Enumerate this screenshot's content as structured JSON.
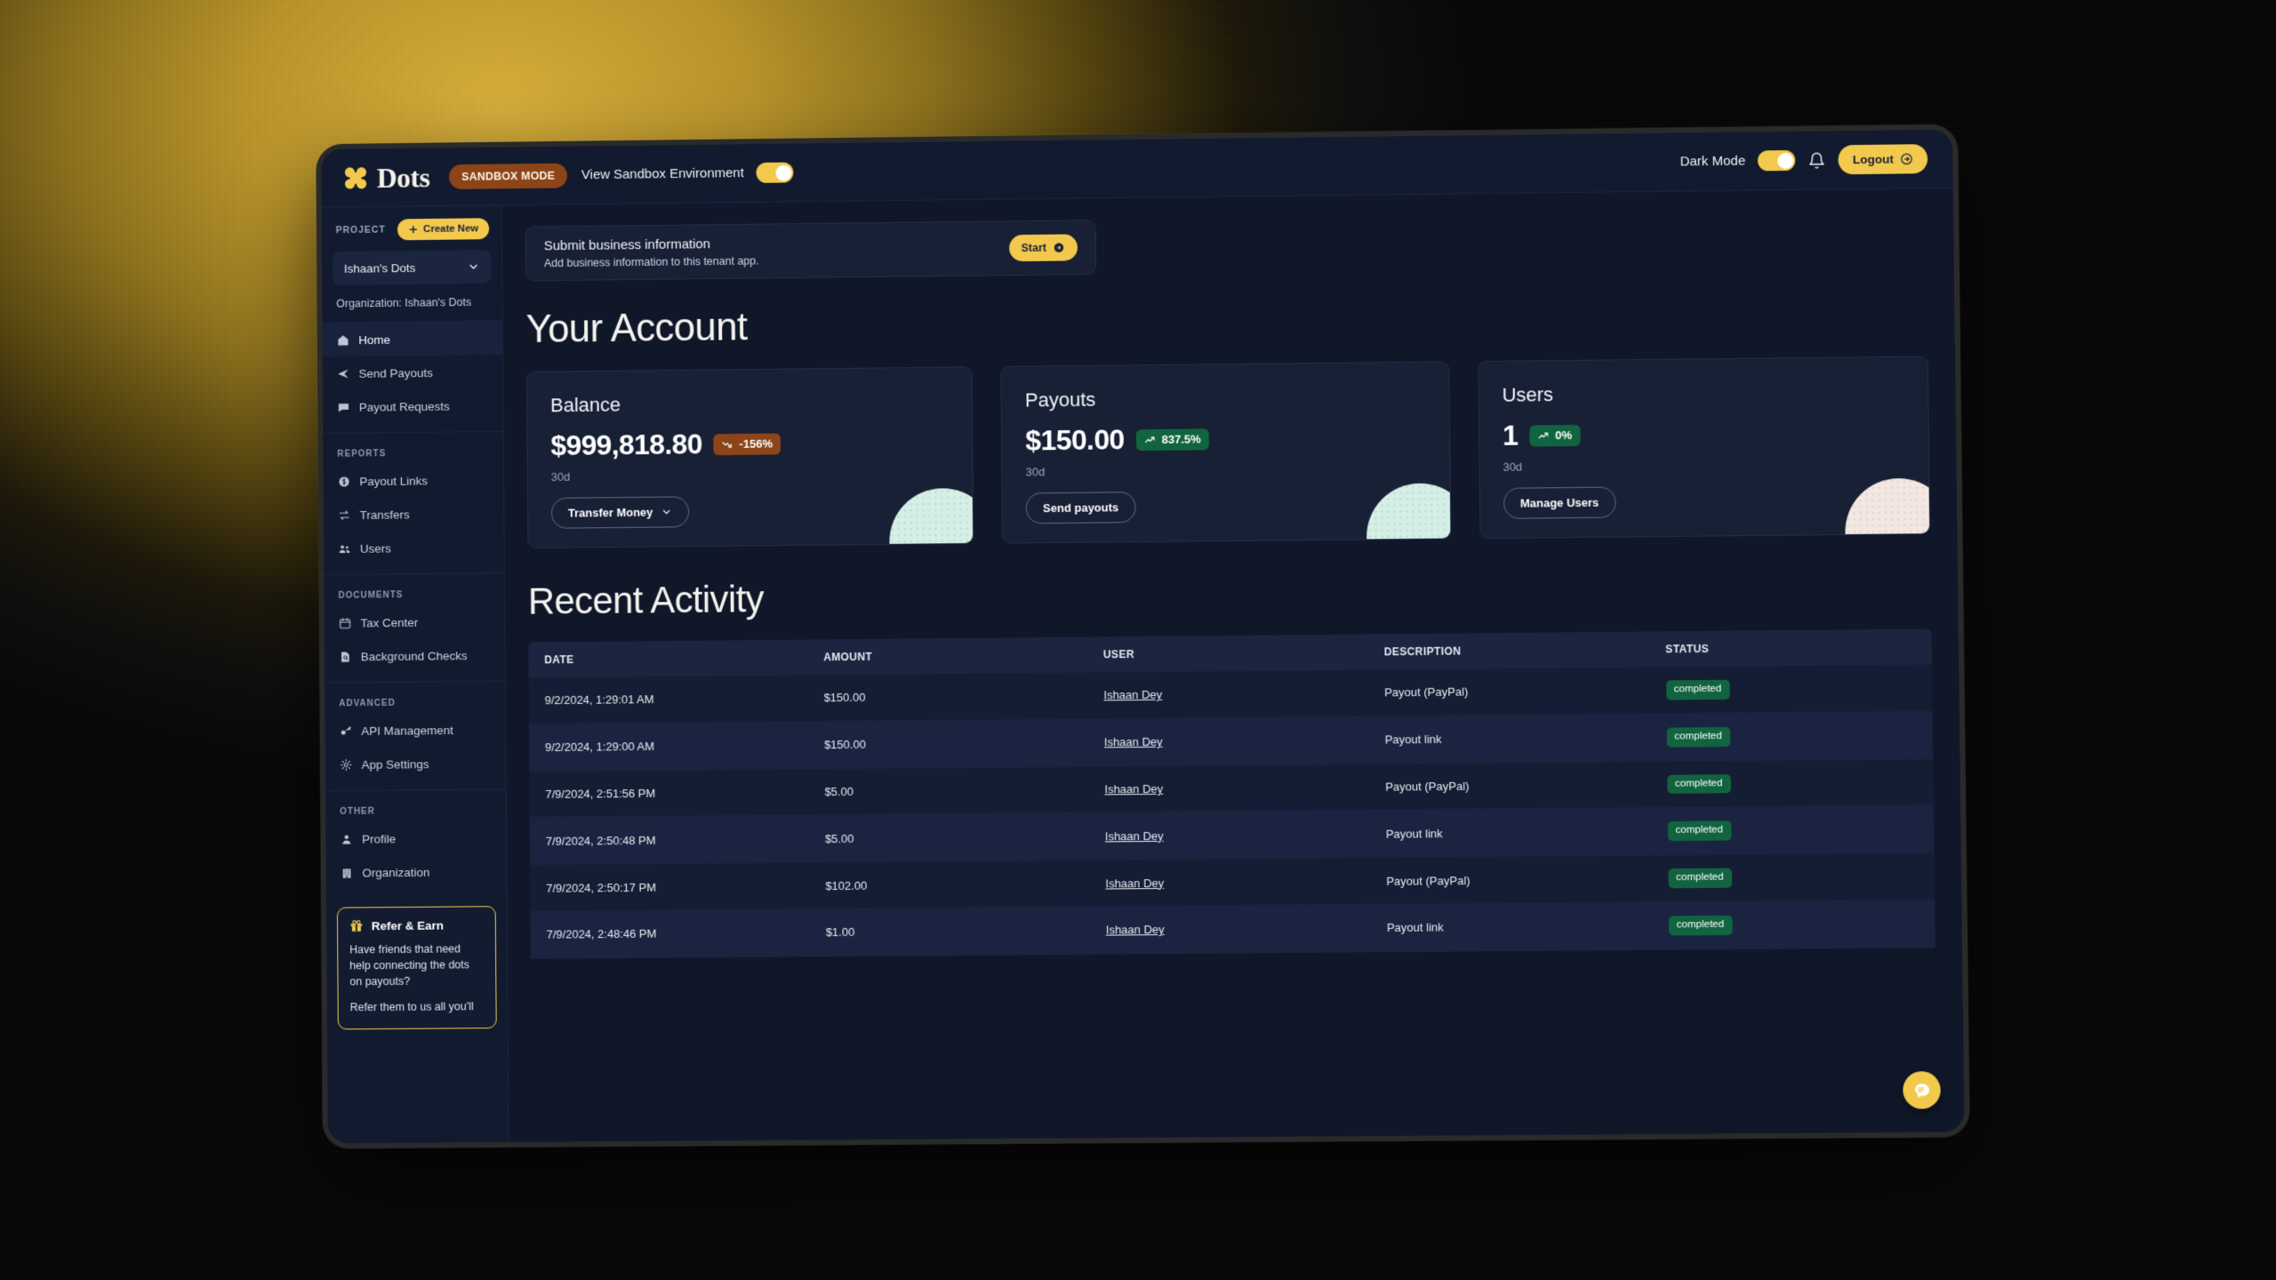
{
  "topbar": {
    "brand": "Dots",
    "sandbox_badge": "SANDBOX MODE",
    "sandbox_toggle_label": "View Sandbox Environment",
    "dark_mode_label": "Dark Mode",
    "logout_label": "Logout"
  },
  "sidebar": {
    "project_label": "PROJECT",
    "create_new_label": "Create New",
    "project_value": "Ishaan's Dots",
    "organization_line": "Organization: Ishaan's Dots",
    "primary_items": [
      {
        "label": "Home",
        "icon": "home-icon",
        "active": true
      },
      {
        "label": "Send Payouts",
        "icon": "send-icon",
        "active": false
      },
      {
        "label": "Payout Requests",
        "icon": "chat-icon",
        "active": false
      }
    ],
    "groups": [
      {
        "label": "REPORTS",
        "items": [
          {
            "label": "Payout Links",
            "icon": "dollar-circle-icon"
          },
          {
            "label": "Transfers",
            "icon": "transfer-icon"
          },
          {
            "label": "Users",
            "icon": "users-icon"
          }
        ]
      },
      {
        "label": "DOCUMENTS",
        "items": [
          {
            "label": "Tax Center",
            "icon": "calendar-icon"
          },
          {
            "label": "Background Checks",
            "icon": "document-search-icon"
          }
        ]
      },
      {
        "label": "ADVANCED",
        "items": [
          {
            "label": "API Management",
            "icon": "key-icon"
          },
          {
            "label": "App Settings",
            "icon": "gear-icon"
          }
        ]
      },
      {
        "label": "OTHER",
        "items": [
          {
            "label": "Profile",
            "icon": "person-icon"
          },
          {
            "label": "Organization",
            "icon": "building-icon"
          }
        ]
      }
    ],
    "refer": {
      "title": "Refer & Earn",
      "paragraph1": "Have friends that need help connecting the dots on payouts?",
      "paragraph2": "Refer them to us all you'll"
    }
  },
  "banner": {
    "title": "Submit business information",
    "subtitle": "Add business information to this tenant app.",
    "button_label": "Start"
  },
  "account": {
    "heading": "Your Account",
    "cards": [
      {
        "title": "Balance",
        "value": "$999,818.80",
        "delta": "-156%",
        "delta_direction": "down",
        "period": "30d",
        "action_label": "Transfer Money",
        "action_has_caret": true,
        "orb": "mint"
      },
      {
        "title": "Payouts",
        "value": "$150.00",
        "delta": "837.5%",
        "delta_direction": "up",
        "period": "30d",
        "action_label": "Send payouts",
        "action_has_caret": false,
        "orb": "mint"
      },
      {
        "title": "Users",
        "value": "1",
        "delta": "0%",
        "delta_direction": "up",
        "period": "30d",
        "action_label": "Manage Users",
        "action_has_caret": false,
        "orb": "pink"
      }
    ]
  },
  "recent_activity": {
    "heading": "Recent Activity",
    "columns": [
      "DATE",
      "AMOUNT",
      "USER",
      "DESCRIPTION",
      "STATUS"
    ],
    "rows": [
      {
        "date": "9/2/2024, 1:29:01 AM",
        "amount": "$150.00",
        "user": "Ishaan Dey",
        "description": "Payout (PayPal)",
        "status": "completed"
      },
      {
        "date": "9/2/2024, 1:29:00 AM",
        "amount": "$150.00",
        "user": "Ishaan Dey",
        "description": "Payout link",
        "status": "completed"
      },
      {
        "date": "7/9/2024, 2:51:56 PM",
        "amount": "$5.00",
        "user": "Ishaan Dey",
        "description": "Payout (PayPal)",
        "status": "completed"
      },
      {
        "date": "7/9/2024, 2:50:48 PM",
        "amount": "$5.00",
        "user": "Ishaan Dey",
        "description": "Payout link",
        "status": "completed"
      },
      {
        "date": "7/9/2024, 2:50:17 PM",
        "amount": "$102.00",
        "user": "Ishaan Dey",
        "description": "Payout (PayPal)",
        "status": "completed"
      },
      {
        "date": "7/9/2024, 2:48:46 PM",
        "amount": "$1.00",
        "user": "Ishaan Dey",
        "description": "Payout link",
        "status": "completed"
      }
    ]
  },
  "colors": {
    "accent_yellow": "#f2c94c",
    "sandbox_orange": "#8c4418",
    "success_green": "#11643f",
    "app_bg": "#0f1729",
    "panel_bg": "#111a2e",
    "card_bg": "#172035"
  }
}
